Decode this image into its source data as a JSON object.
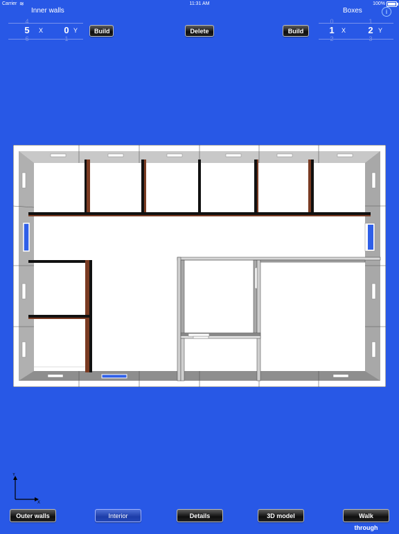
{
  "status": {
    "carrier": "Carrier",
    "time": "11:31 AM",
    "battery": "100%"
  },
  "left_panel": {
    "title": "Inner walls",
    "picker": {
      "x_value": "5",
      "x_above": "4",
      "x_below": "6",
      "x_axis": "X",
      "y_value": "0",
      "y_below": "1",
      "y_axis": "Y"
    },
    "build_label": "Build"
  },
  "center": {
    "delete_label": "Delete"
  },
  "right_panel": {
    "title": "Boxes",
    "build_label": "Build",
    "picker": {
      "x_value": "1",
      "x_above": "0",
      "x_below": "2",
      "x_axis": "X",
      "y_value": "2",
      "y_above": "1",
      "y_below": "3",
      "y_axis": "Y"
    }
  },
  "axis_indicator": {
    "y": "Y",
    "x": "X"
  },
  "tabs": [
    {
      "label": "Outer walls",
      "active": false
    },
    {
      "label": "Interior",
      "active": true
    },
    {
      "label": "Details",
      "active": false
    },
    {
      "label": "3D model",
      "active": false
    },
    {
      "label": "Walk through",
      "active": false
    }
  ],
  "colors": {
    "background": "#2858e6",
    "wall_brick": "#7a3b22",
    "window_blue": "#2f5fe8"
  }
}
